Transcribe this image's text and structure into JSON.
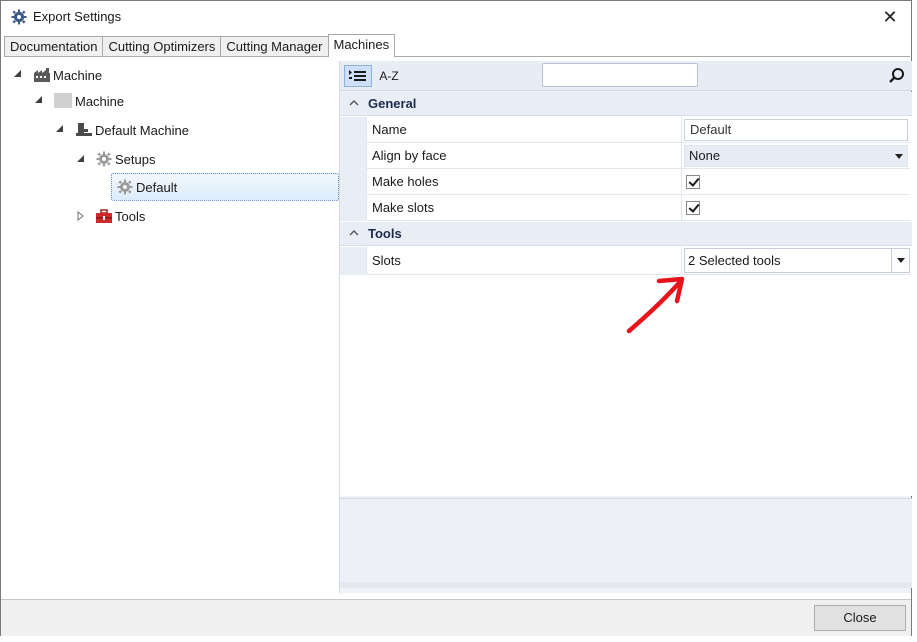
{
  "window": {
    "title": "Export Settings",
    "close_icon": "close-icon"
  },
  "tabs": [
    {
      "label": "Documentation",
      "active": false
    },
    {
      "label": "Cutting Optimizers",
      "active": false
    },
    {
      "label": "Cutting Manager",
      "active": false
    },
    {
      "label": "Machines",
      "active": true
    }
  ],
  "tree": {
    "nodes": [
      {
        "label": "Machine",
        "icon": "factory-icon",
        "expanded": true
      },
      {
        "label": "Machine",
        "icon": "gray-square-icon",
        "expanded": true
      },
      {
        "label": "Default Machine",
        "icon": "machine-icon",
        "expanded": true
      },
      {
        "label": "Setups",
        "icon": "gear-icon",
        "expanded": true
      },
      {
        "label": "Default",
        "icon": "gear-icon",
        "selected": true
      },
      {
        "label": "Tools",
        "icon": "toolbox-icon",
        "expanded": false
      }
    ]
  },
  "property_grid": {
    "toolbar": {
      "categorized_icon": "categorized-icon",
      "alpha_label": "A-Z",
      "search_value": "",
      "search_icon": "search-icon"
    },
    "categories": [
      {
        "label": "General",
        "rows": [
          {
            "name": "Name",
            "value": "Default",
            "kind": "text"
          },
          {
            "name": "Align by face",
            "value": "None",
            "kind": "dropdown"
          },
          {
            "name": "Make holes",
            "value": true,
            "kind": "checkbox"
          },
          {
            "name": "Make slots",
            "value": true,
            "kind": "checkbox"
          }
        ]
      },
      {
        "label": "Tools",
        "rows": [
          {
            "name": "Slots",
            "value": "2 Selected tools",
            "kind": "dropdown"
          }
        ]
      }
    ]
  },
  "footer": {
    "close_label": "Close"
  },
  "colors": {
    "accent_selection": "#cde0f7",
    "annotation_arrow": "#e8141c"
  }
}
